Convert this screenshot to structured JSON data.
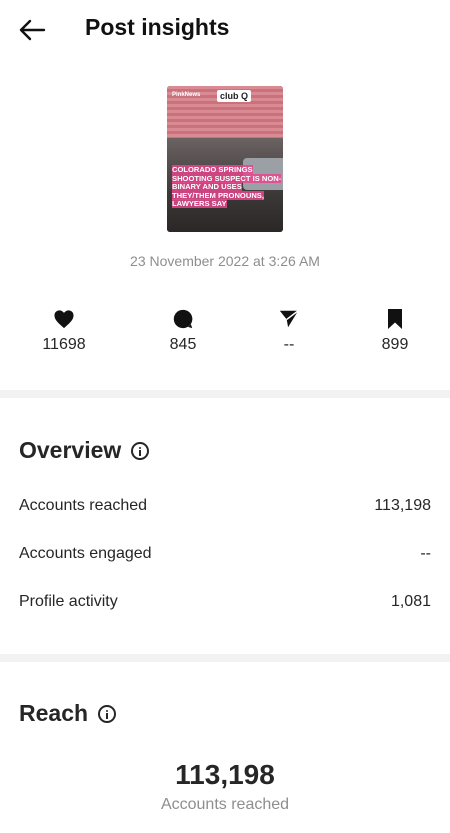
{
  "header": {
    "title": "Post insights",
    "back_icon": "arrow-left-icon"
  },
  "post": {
    "thumbnail": {
      "brand": "PinkNews",
      "sign": "club Q",
      "headline": "COLORADO SPRINGS SHOOTING SUSPECT IS NON-BINARY AND USES THEY/THEM PRONOUNS, LAWYERS SAY",
      "overlay_color": "#e4468c"
    },
    "date": "23 November 2022 at 3:26 AM"
  },
  "stats": [
    {
      "icon": "heart-icon",
      "value": "11698"
    },
    {
      "icon": "comment-icon",
      "value": "845"
    },
    {
      "icon": "send-icon",
      "value": "--"
    },
    {
      "icon": "bookmark-icon",
      "value": "899"
    }
  ],
  "overview": {
    "title": "Overview",
    "info_icon": "info-icon",
    "rows": [
      {
        "label": "Accounts reached",
        "value": "113,198"
      },
      {
        "label": "Accounts engaged",
        "value": "--"
      },
      {
        "label": "Profile activity",
        "value": "1,081"
      }
    ]
  },
  "reach": {
    "title": "Reach",
    "info_icon": "info-icon",
    "value": "113,198",
    "label": "Accounts reached"
  },
  "colors": {
    "text": "#262626",
    "muted": "#8e8e8e",
    "divider": "#f2f2f2"
  }
}
